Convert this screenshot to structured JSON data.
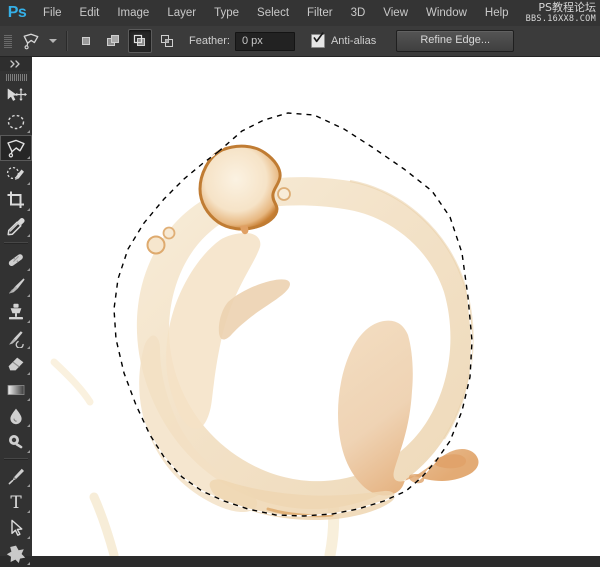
{
  "app": {
    "name": "Adobe Photoshop",
    "logo_text": "Ps",
    "logo_color": "#35b0e8"
  },
  "menubar": {
    "items": [
      {
        "label": "File",
        "mnemonic": "F"
      },
      {
        "label": "Edit",
        "mnemonic": "E"
      },
      {
        "label": "Image",
        "mnemonic": "I"
      },
      {
        "label": "Layer",
        "mnemonic": "L"
      },
      {
        "label": "Type",
        "mnemonic": "y"
      },
      {
        "label": "Select",
        "mnemonic": "S"
      },
      {
        "label": "Filter",
        "mnemonic": "t"
      },
      {
        "label": "3D",
        "mnemonic": "D"
      },
      {
        "label": "View",
        "mnemonic": "V"
      },
      {
        "label": "Window",
        "mnemonic": "W"
      },
      {
        "label": "Help",
        "mnemonic": "H"
      }
    ],
    "watermark_cn": "PS教程论坛",
    "watermark_en": "BBS.16XX8.COM"
  },
  "optionsbar": {
    "active_tool_icon": "polygonal-lasso-icon",
    "tool_preset_caret": "chevron-down-icon",
    "selection_modes": [
      {
        "name": "new-selection",
        "title": "New selection",
        "active": false
      },
      {
        "name": "add-to-selection",
        "title": "Add to selection",
        "active": false
      },
      {
        "name": "subtract-from-selection",
        "title": "Subtract from selection",
        "active": true
      },
      {
        "name": "intersect-selection",
        "title": "Intersect with selection",
        "active": false
      }
    ],
    "feather_label": "Feather:",
    "feather_value": "0 px",
    "feather_placeholder": "0 px",
    "antialias_label": "Anti-alias",
    "antialias_checked": true,
    "refine_edge_label": "Refine Edge..."
  },
  "toolbar": {
    "collapse_icon": "double-chevron-right-icon",
    "groups": [
      {
        "tools": [
          {
            "name": "move-tool",
            "icon": "move-icon",
            "active": false,
            "has_flyout": false
          },
          {
            "name": "elliptical-marquee-tool",
            "icon": "ellipse-marquee-icon",
            "active": false,
            "has_flyout": true
          },
          {
            "name": "lasso-tool",
            "icon": "polygonal-lasso-icon",
            "active": true,
            "has_flyout": true
          },
          {
            "name": "quick-selection-tool",
            "icon": "quick-selection-icon",
            "active": false,
            "has_flyout": true
          },
          {
            "name": "crop-tool",
            "icon": "crop-icon",
            "active": false,
            "has_flyout": true
          },
          {
            "name": "eyedropper-tool",
            "icon": "eyedropper-icon",
            "active": false,
            "has_flyout": true
          }
        ]
      },
      {
        "tools": [
          {
            "name": "spot-healing-brush-tool",
            "icon": "healing-brush-icon",
            "active": false,
            "has_flyout": true
          },
          {
            "name": "brush-tool",
            "icon": "brush-icon",
            "active": false,
            "has_flyout": true
          },
          {
            "name": "clone-stamp-tool",
            "icon": "clone-stamp-icon",
            "active": false,
            "has_flyout": true
          },
          {
            "name": "history-brush-tool",
            "icon": "history-brush-icon",
            "active": false,
            "has_flyout": true
          },
          {
            "name": "eraser-tool",
            "icon": "eraser-icon",
            "active": false,
            "has_flyout": true
          },
          {
            "name": "gradient-tool",
            "icon": "gradient-icon",
            "active": false,
            "has_flyout": true
          },
          {
            "name": "blur-tool",
            "icon": "blur-drop-icon",
            "active": false,
            "has_flyout": true
          },
          {
            "name": "dodge-tool",
            "icon": "dodge-icon",
            "active": false,
            "has_flyout": true
          }
        ]
      },
      {
        "tools": [
          {
            "name": "pen-tool",
            "icon": "pen-nib-icon",
            "active": false,
            "has_flyout": true
          },
          {
            "name": "type-tool",
            "icon": "type-t-icon",
            "active": false,
            "has_flyout": true
          },
          {
            "name": "path-selection-tool",
            "icon": "path-arrow-icon",
            "active": false,
            "has_flyout": true
          },
          {
            "name": "custom-shape-tool",
            "icon": "custom-shape-icon",
            "active": false,
            "has_flyout": true
          }
        ]
      }
    ]
  },
  "canvas": {
    "background": "#ffffff",
    "document_content": "coffee-cup-ring-stain",
    "selection_state": "active-marching-ants-polygonal-lasso",
    "stain_colors": {
      "light": "#f8edd9",
      "mid": "#f0d9b8",
      "edge": "#dba36a",
      "dark": "#c0772f"
    }
  }
}
